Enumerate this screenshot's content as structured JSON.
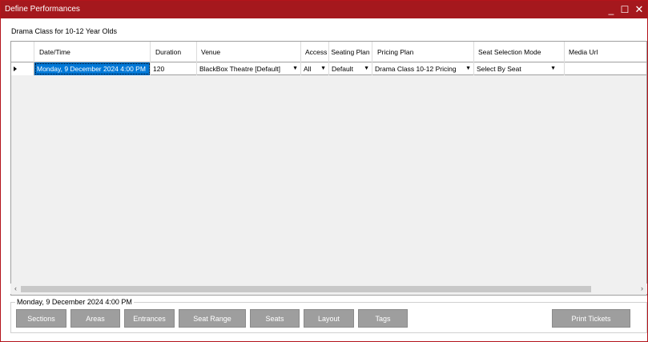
{
  "window": {
    "title": "Define Performances",
    "minimize_label": "_",
    "maximize_label": "☐",
    "close_label": "✕"
  },
  "heading": "Drama Class for 10-12 Year Olds",
  "grid": {
    "columns": [
      "Date/Time",
      "Duration",
      "Venue",
      "Access",
      "Seating Plan",
      "Pricing Plan",
      "Seat Selection Mode",
      "Media Url"
    ],
    "rows": [
      {
        "datetime": "Monday, 9 December 2024 4:00 PM",
        "duration": "120",
        "venue": "BlackBox Theatre [Default]",
        "access": "All",
        "seating_plan": "Default",
        "pricing_plan": "Drama Class 10-12 Pricing",
        "seat_selection_mode": "Select By Seat",
        "media_url": ""
      }
    ]
  },
  "scroll": {
    "left_arrow": "‹",
    "right_arrow": "›"
  },
  "details": {
    "legend": "Monday, 9 December 2024 4:00 PM",
    "buttons": [
      "Sections",
      "Areas",
      "Entrances",
      "Seat Range",
      "Seats",
      "Layout",
      "Tags"
    ],
    "print_label": "Print Tickets"
  },
  "colors": {
    "titlebar": "#a5181d",
    "selection": "#0078d7",
    "button": "#9e9e9e"
  }
}
